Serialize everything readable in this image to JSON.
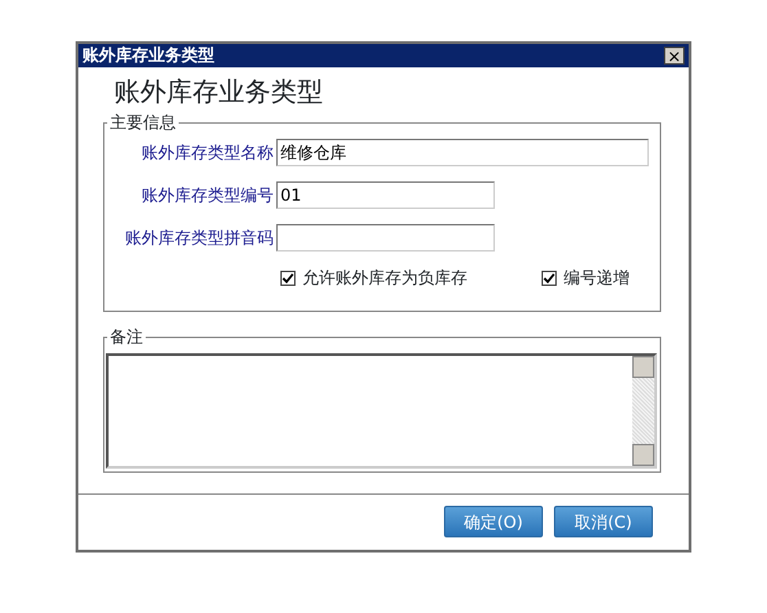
{
  "window": {
    "title": "账外库存业务类型",
    "close": "×"
  },
  "heading": "账外库存业务类型",
  "main_info": {
    "legend": "主要信息",
    "fields": [
      {
        "label": "账外库存类型名称",
        "value": "维修仓库"
      },
      {
        "label": "账外库存类型编号",
        "value": "01"
      },
      {
        "label": "账外库存类型拼音码"
      }
    ],
    "checkboxes": [
      {
        "label": "允许账外库存为负库存",
        "checked": true
      },
      {
        "label": "编号递增",
        "checked": true
      }
    ]
  },
  "remarks": {
    "legend": "备注"
  },
  "buttons": [
    "确定(O)",
    "取消(C)"
  ]
}
